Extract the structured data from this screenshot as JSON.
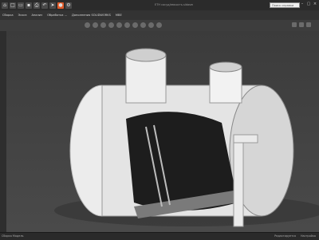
{
  "window": {
    "title": "ЕТН сосуд/емкость.sldasm"
  },
  "search": {
    "placeholder": "Поиск справки"
  },
  "tabs": [
    "Сборка",
    "Эскиз",
    "Анализ",
    "Обработка ...",
    "Дополнения SOLIDWORKS",
    "МВЕ"
  ],
  "statusbar": {
    "tab": "Сборка Модель",
    "right1": "Редактируется",
    "right2": "Настройка"
  },
  "icons": [
    "home-icon",
    "new-icon",
    "open-icon",
    "save-icon",
    "print-icon",
    "undo-icon",
    "select-icon",
    "rebuild-icon",
    "options-icon"
  ],
  "colors": {
    "accent": "#e05a28",
    "viewport_top": "#3b3b3b",
    "viewport_bottom": "#4a4a4a"
  }
}
